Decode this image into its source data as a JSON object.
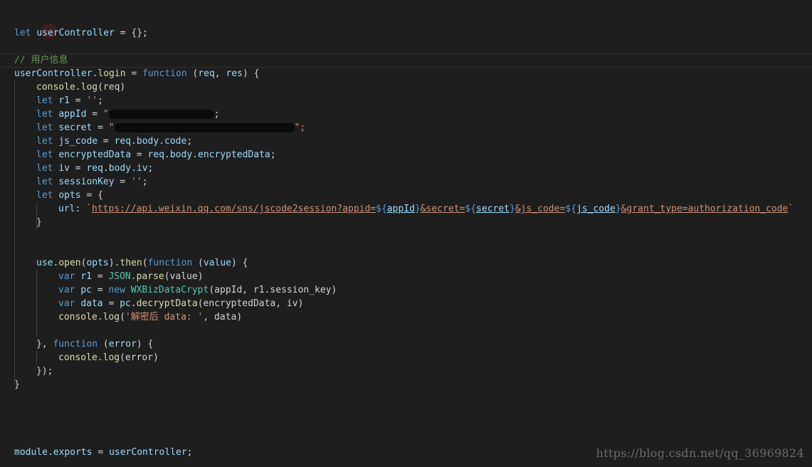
{
  "code": {
    "l1": {
      "kw": "let",
      "name": "userController",
      "rest": " = {};"
    },
    "l2": {
      "comment": "// 用户信息"
    },
    "l3": {
      "obj": "userController",
      "prop": "login",
      "eq": " = ",
      "kw": "function",
      "open": " (",
      "p1": "req",
      "comma": ", ",
      "p2": "res",
      "close": ") {"
    },
    "l4": {
      "obj": "console",
      "fn": "log",
      "args": "(req)"
    },
    "l5": {
      "kw": "let",
      "name": "r1",
      "eq": " = ",
      "val": "''",
      "semi": ";"
    },
    "l6": {
      "kw": "let",
      "name": "appId",
      "eq": " = ",
      "q1": "\"",
      "tail": ";"
    },
    "l7": {
      "kw": "let",
      "name": "secret",
      "eq": " = ",
      "q1": "\"",
      "tail": "\";"
    },
    "l8": {
      "kw": "let",
      "name": "js_code",
      "eq": " = ",
      "rhs": "req.body.code",
      "semi": ";"
    },
    "l9": {
      "kw": "let",
      "name": "encryptedData",
      "eq": " = ",
      "rhs": "req.body.encryptedData",
      "semi": ";"
    },
    "l10": {
      "kw": "let",
      "name": "iv",
      "eq": " = ",
      "rhs": "req.body.iv",
      "semi": ";"
    },
    "l11": {
      "kw": "let",
      "name": "sessionKey",
      "eq": " = ",
      "val": "''",
      "semi": ";"
    },
    "l12": {
      "kw": "let",
      "name": "opts",
      "eq": " = {"
    },
    "l13": {
      "key": "url",
      "colon": ": ",
      "bt": "`",
      "url": "https://api.weixin.qq.com/sns/jscode2session?appid=",
      "t1o": "${",
      "t1v": "appId",
      "t1c": "}",
      "s2": "&secret=",
      "t2o": "${",
      "t2v": "secret",
      "t2c": "}",
      "s3": "&js_code=",
      "t3o": "${",
      "t3v": "js_code",
      "t3c": "}",
      "s4": "&grant_type=authorization_code",
      "bt2": "`"
    },
    "l14": {
      "text": "}"
    },
    "l15": {
      "obj": "use",
      "fn": "open",
      "args1": "(",
      "arg": "opts",
      "mid": ").",
      "fn2": "then",
      "open": "(",
      "kw": "function",
      "sp": " (",
      "p": "value",
      "close": ") {"
    },
    "l16": {
      "kw": "var",
      "name": "r1",
      "eq": " = ",
      "cls": "JSON",
      "dot": ".",
      "fn": "parse",
      "args": "(value)"
    },
    "l17": {
      "kw": "var",
      "name": "pc",
      "eq": " = ",
      "kw2": "new",
      "cls": "WXBizDataCrypt",
      "args": "(appId, r1.session_key)"
    },
    "l18": {
      "kw": "var",
      "name": "data",
      "eq": " = ",
      "obj": "pc",
      "dot": ".",
      "fn": "decryptData",
      "args": "(encryptedData, iv)"
    },
    "l19": {
      "obj": "console",
      "fn": "log",
      "open": "(",
      "str": "'解密后 data: '",
      "rest": ", data)"
    },
    "l20": {
      "pre": "}, ",
      "kw": "function",
      "sp": " (",
      "p": "error",
      "close": ") {"
    },
    "l21": {
      "obj": "console",
      "fn": "log",
      "args": "(error)"
    },
    "l22": {
      "text": "});"
    },
    "l23": {
      "text": "}"
    },
    "l24": {
      "obj": "module",
      "prop": "exports",
      "eq": " = ",
      "name": "userController",
      "semi": ";"
    }
  },
  "watermark": "https://blog.csdn.net/qq_36969824",
  "colors": {
    "background": "#1e1e1e",
    "keyword": "#569cd6",
    "variable": "#9cdcfe",
    "function": "#dcdcaa",
    "class": "#4ec9b0",
    "string": "#ce9178",
    "comment": "#6a9955"
  }
}
